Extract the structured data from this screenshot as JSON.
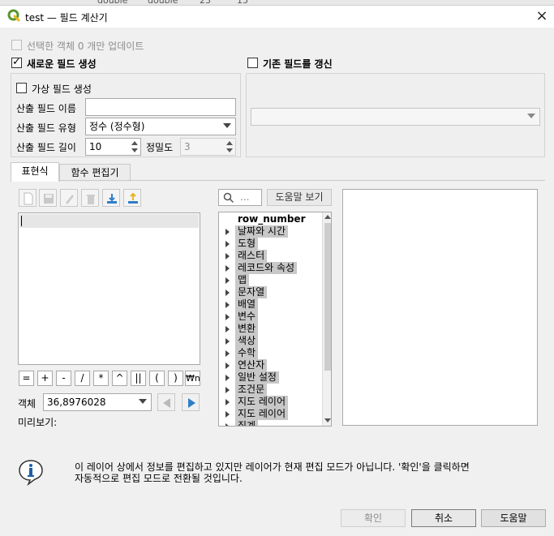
{
  "background_strip": [
    "double",
    "double",
    "23",
    "15"
  ],
  "window": {
    "title": "test — 필드 계산기",
    "close": "×"
  },
  "update_selected": {
    "label": "선택한 객체 0 개만 업데이트",
    "checked": false,
    "enabled": false
  },
  "new_field": {
    "label": "새로운 필드 생성",
    "checked": true,
    "virtual_label": "가상 필드 생성",
    "name_label": "산출 필드 이름",
    "name_value": "",
    "type_label": "산출 필드 유형",
    "type_value": "정수 (정수형)",
    "length_label": "산출 필드 길이",
    "length_value": "10",
    "precision_label": "정밀도",
    "precision_value": "3"
  },
  "update_existing": {
    "label": "기존 필드를 갱신",
    "checked": false,
    "field_value": ""
  },
  "tabs": [
    "표현식",
    "함수 편집기"
  ],
  "toolbar_icons": [
    "new-file-icon",
    "save-icon",
    "edit-icon",
    "delete-icon",
    "load-icon",
    "export-icon"
  ],
  "search": {
    "placeholder": "..."
  },
  "help_button": "도움말 보기",
  "operators": [
    "=",
    "+",
    "-",
    "/",
    "*",
    "^",
    "||",
    "(",
    ")",
    "₩n"
  ],
  "feature": {
    "label": "객체",
    "value": "36,8976028"
  },
  "preview_label": "미리보기:",
  "function_list": [
    {
      "label": "row_number",
      "expandable": false
    },
    {
      "label": "날짜와 시간",
      "expandable": true
    },
    {
      "label": "도형",
      "expandable": true
    },
    {
      "label": "래스터",
      "expandable": true
    },
    {
      "label": "레코드와 속성",
      "expandable": true
    },
    {
      "label": "맵",
      "expandable": true
    },
    {
      "label": "문자열",
      "expandable": true
    },
    {
      "label": "배열",
      "expandable": true
    },
    {
      "label": "변수",
      "expandable": true
    },
    {
      "label": "변환",
      "expandable": true
    },
    {
      "label": "색상",
      "expandable": true
    },
    {
      "label": "수학",
      "expandable": true
    },
    {
      "label": "연산자",
      "expandable": true
    },
    {
      "label": "일반 설정",
      "expandable": true
    },
    {
      "label": "조건문",
      "expandable": true
    },
    {
      "label": "지도 레이어",
      "expandable": true
    },
    {
      "label": "지도 레이어",
      "expandable": true
    },
    {
      "label": "집계",
      "expandable": true
    }
  ],
  "info_message": {
    "line1": "이 레이어 상에서 정보를 편집하고 있지만 레이어가 현재 편집 모드가 아닙니다. '확인'을 클릭하면",
    "line2": "자동적으로 편집 모드로 전환될 것입니다."
  },
  "buttons": {
    "ok": "확인",
    "cancel": "취소",
    "help": "도움말"
  },
  "colors": {
    "qgis_green": "#589632",
    "info_blue": "#1f5fa8",
    "accent_blue": "#2f7ec7"
  }
}
